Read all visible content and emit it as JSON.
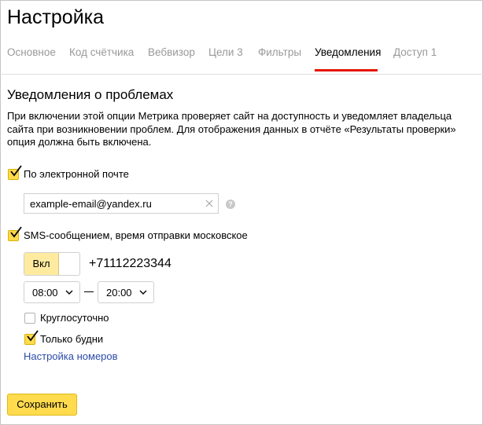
{
  "page": {
    "title": "Настройка"
  },
  "tabs": [
    {
      "label": "Основное",
      "active": false
    },
    {
      "label": "Код счётчика",
      "active": false
    },
    {
      "label": "Вебвизор",
      "active": false
    },
    {
      "label": "Цели 3",
      "active": false
    },
    {
      "label": "Фильтры",
      "active": false
    },
    {
      "label": "Уведомления",
      "active": true
    },
    {
      "label": "Доступ 1",
      "active": false
    }
  ],
  "colors": {
    "accent": "#ffdb4d",
    "tab_underline": "#e61400",
    "link": "#2c4ba8",
    "inactive_tab": "#999999"
  },
  "section": {
    "title": "Уведомления о проблемах",
    "description": "При включении этой опции Метрика проверяет сайт на доступность и уведомляет владельца сайта при возникновении проблем. Для отображения данных в отчёте «Результаты проверки» опция должна быть включена."
  },
  "email": {
    "checkbox_label": "По электронной почте",
    "checked": true,
    "input_value": "example-email@yandex.ru",
    "clear_icon": "close-icon",
    "help_icon": "question-icon",
    "help_glyph": "?"
  },
  "sms": {
    "checkbox_label": "SMS-сообщением, время отправки московское",
    "checked": true,
    "toggle_label": "Вкл",
    "phone": "+71112223344",
    "time_from": "08:00",
    "time_to": "20:00",
    "around_clock_label": "Круглосуточно",
    "around_clock_checked": false,
    "weekdays_label": "Только будни",
    "weekdays_checked": true,
    "numbers_link": "Настройка номеров"
  },
  "actions": {
    "save_label": "Сохранить"
  }
}
